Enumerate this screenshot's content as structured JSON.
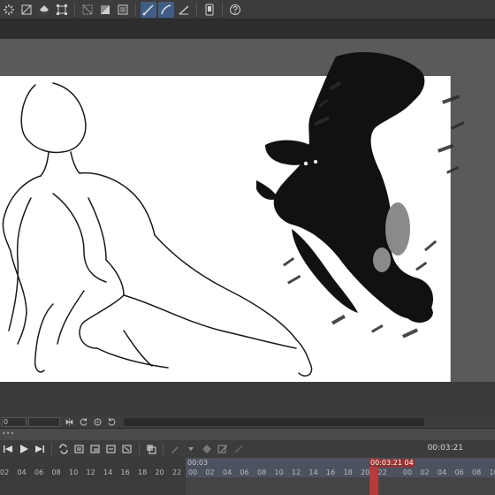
{
  "command_bar": {
    "icons": [
      "loading-spinner-icon",
      "clear-icon",
      "fill-icon",
      "transform-icon",
      "selection-out-icon",
      "mask-icon",
      "frame-icon",
      "line-tool-icon",
      "curve-tool-icon",
      "vector-tool-icon",
      "device-icon",
      "help-icon"
    ],
    "active": [
      "line-tool-icon",
      "curve-tool-icon"
    ]
  },
  "navigator": {
    "zoom_value": "0"
  },
  "timeline": {
    "start_time": "00:03",
    "playhead_time": "00:03:21",
    "playhead_suffix": "04",
    "end_time": "00:03:21",
    "frames_left": [
      "02",
      "04",
      "06",
      "08",
      "10",
      "12",
      "14",
      "16",
      "18",
      "20",
      "22"
    ],
    "frames_right": [
      "00",
      "02",
      "04",
      "06",
      "08",
      "10",
      "12",
      "14",
      "16",
      "18",
      "20",
      "22"
    ],
    "frames_far_right": [
      "00",
      "02",
      "04",
      "06",
      "08",
      "10"
    ],
    "colors": {
      "accent": "#3f5d86",
      "playhead": "#b63b3b",
      "range": "#4c5260"
    }
  }
}
